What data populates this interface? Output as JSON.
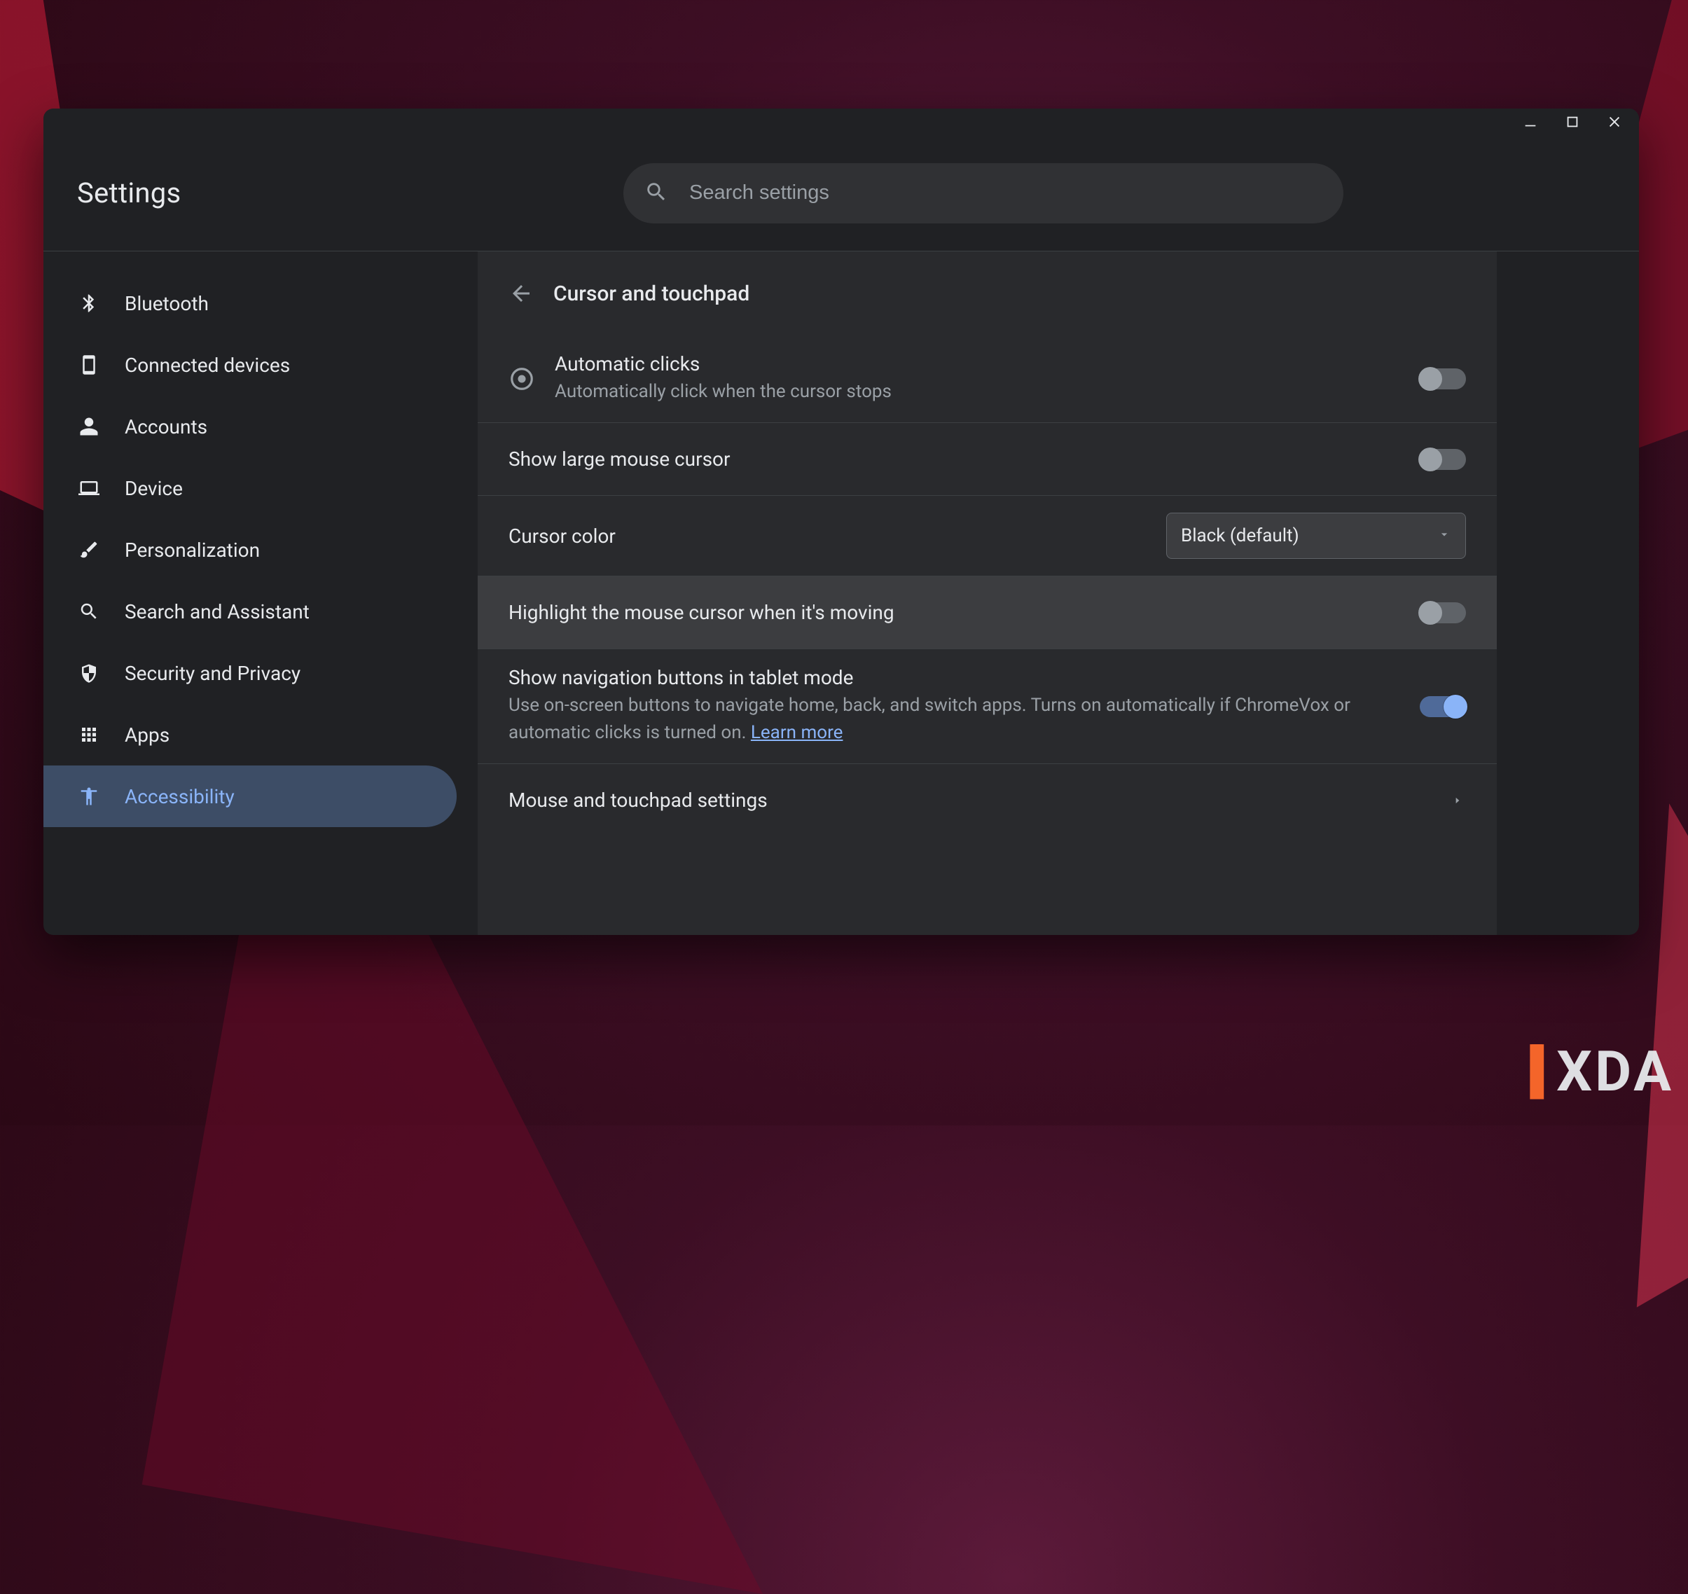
{
  "app_title": "Settings",
  "search": {
    "placeholder": "Search settings"
  },
  "window_controls": {
    "minimize": "minimize",
    "maximize": "maximize",
    "close": "close"
  },
  "sidebar": {
    "items": [
      {
        "icon": "bluetooth-icon",
        "label": "Bluetooth",
        "active": false
      },
      {
        "icon": "devices-icon",
        "label": "Connected devices",
        "active": false
      },
      {
        "icon": "person-icon",
        "label": "Accounts",
        "active": false
      },
      {
        "icon": "laptop-icon",
        "label": "Device",
        "active": false
      },
      {
        "icon": "brush-icon",
        "label": "Personalization",
        "active": false
      },
      {
        "icon": "search-icon",
        "label": "Search and Assistant",
        "active": false
      },
      {
        "icon": "shield-icon",
        "label": "Security and Privacy",
        "active": false
      },
      {
        "icon": "apps-icon",
        "label": "Apps",
        "active": false
      },
      {
        "icon": "accessibility-icon",
        "label": "Accessibility",
        "active": true
      }
    ]
  },
  "page": {
    "title": "Cursor and touchpad",
    "rows": {
      "automatic_clicks": {
        "title": "Automatic clicks",
        "subtitle": "Automatically click when the cursor stops",
        "enabled": false
      },
      "large_cursor": {
        "title": "Show large mouse cursor",
        "enabled": false
      },
      "cursor_color": {
        "title": "Cursor color",
        "selected": "Black (default)"
      },
      "highlight_moving": {
        "title": "Highlight the mouse cursor when it's moving",
        "enabled": false
      },
      "nav_tablet": {
        "title": "Show navigation buttons in tablet mode",
        "subtitle": "Use on-screen buttons to navigate home, back, and switch apps. Turns on automatically if ChromeVox or automatic clicks is turned on. ",
        "learn_more": "Learn more",
        "enabled": true
      },
      "mouse_touchpad": {
        "title": "Mouse and touchpad settings"
      }
    }
  },
  "watermark": {
    "bracket_open": "[",
    "bracket_close": "]",
    "text": "XDA"
  }
}
